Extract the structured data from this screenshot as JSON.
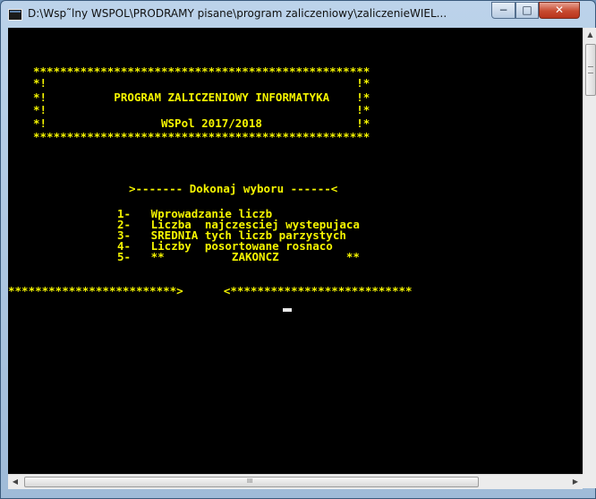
{
  "window": {
    "title": "D:\\Wsp˜lny WSPOL\\PRODRAMY pisane\\program zaliczeniowy\\zaliczenieWIEL...",
    "minimize_glyph": "−",
    "maximize_glyph": "□",
    "close_glyph": "✕"
  },
  "console": {
    "text_color": "#f5f500",
    "background": "#000000",
    "lines": [
      "**************************************************",
      "*!                                              !*",
      "*!          PROGRAM ZALICZENIOWY INFORMATYKA    !*",
      "*!                                              !*",
      "*!                 WSPol 2017/2018              !*",
      "**************************************************",
      ">------- Dokonaj wyboru ------<",
      "1-   Wprowadzanie liczb",
      "2-   Liczba  najczesciej wystepujaca",
      "3-   SREDNIA tych liczb parzystych",
      "4-   Liczby  posortowane rosnaco",
      "5-   **          ZAKONCZ          **",
      "*************************>      <***************************"
    ]
  },
  "scrollbars": {
    "up_glyph": "▲",
    "down_glyph": "▼",
    "left_glyph": "◀",
    "right_glyph": "▶",
    "h_grip": "III"
  }
}
